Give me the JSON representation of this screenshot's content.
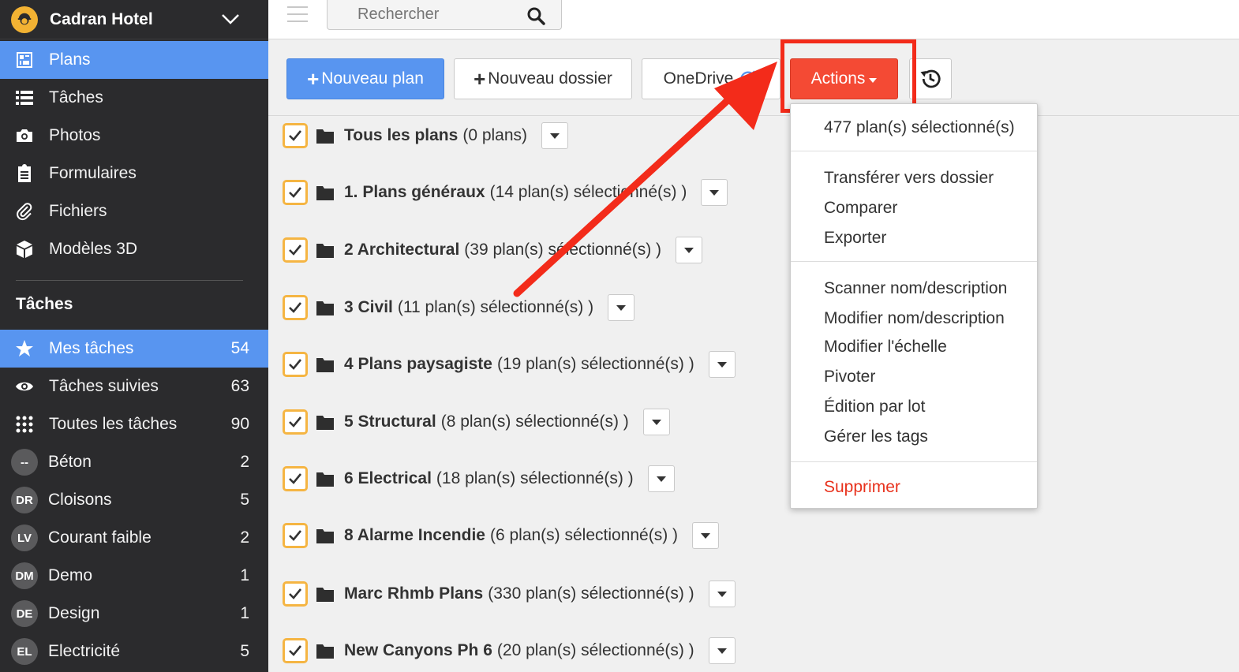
{
  "brand": {
    "name": "Cadran Hotel"
  },
  "nav": [
    {
      "label": "Plans",
      "icon": "plans-icon",
      "active": true
    },
    {
      "label": "Tâches",
      "icon": "list-icon"
    },
    {
      "label": "Photos",
      "icon": "camera-icon"
    },
    {
      "label": "Formulaires",
      "icon": "clipboard-icon"
    },
    {
      "label": "Fichiers",
      "icon": "paperclip-icon"
    },
    {
      "label": "Modèles 3D",
      "icon": "cube-icon"
    }
  ],
  "tasks_section": {
    "title": "Tâches",
    "items": [
      {
        "label": "Mes tâches",
        "count": "54",
        "icon": "star-icon",
        "active": true
      },
      {
        "label": "Tâches suivies",
        "count": "63",
        "icon": "eye-icon"
      },
      {
        "label": "Toutes les tâches",
        "count": "90",
        "icon": "grid-icon"
      },
      {
        "label": "Béton",
        "count": "2",
        "avatar": "--"
      },
      {
        "label": "Cloisons",
        "count": "5",
        "avatar": "DR"
      },
      {
        "label": "Courant faible",
        "count": "2",
        "avatar": "LV"
      },
      {
        "label": "Demo",
        "count": "1",
        "avatar": "DM"
      },
      {
        "label": "Design",
        "count": "1",
        "avatar": "DE"
      },
      {
        "label": "Electricité",
        "count": "5",
        "avatar": "EL"
      }
    ]
  },
  "search": {
    "placeholder": "Rechercher"
  },
  "toolbar": {
    "new_plan": "Nouveau plan",
    "new_folder": "Nouveau dossier",
    "onedrive": "OneDrive",
    "actions": "Actions"
  },
  "folders": [
    {
      "name": "Tous les plans",
      "detail": "(0 plans)"
    },
    {
      "name": "1. Plans généraux",
      "detail": "(14 plan(s) sélectionné(s) )"
    },
    {
      "name": "2 Architectural",
      "detail": "(39 plan(s) sélectionné(s) )"
    },
    {
      "name": "3 Civil",
      "detail": "(11 plan(s) sélectionné(s) )"
    },
    {
      "name": "4 Plans paysagiste",
      "detail": "(19 plan(s) sélectionné(s) )"
    },
    {
      "name": "5 Structural",
      "detail": "(8 plan(s) sélectionné(s) )"
    },
    {
      "name": "6 Electrical",
      "detail": "(18 plan(s) sélectionné(s) )"
    },
    {
      "name": "8 Alarme Incendie",
      "detail": "(6 plan(s) sélectionné(s) )"
    },
    {
      "name": "Marc Rhmb Plans",
      "detail": "(330 plan(s) sélectionné(s) )"
    },
    {
      "name": "New Canyons Ph 6",
      "detail": "(20 plan(s) sélectionné(s) )"
    }
  ],
  "actions_menu": {
    "selected_count": "477 plan(s) sélectionné(s)",
    "group1": [
      "Transférer vers dossier",
      "Comparer",
      "Exporter"
    ],
    "group2": [
      "Scanner nom/description",
      "Modifier nom/description",
      "Modifier l'échelle",
      "Pivoter",
      "Édition par lot",
      "Gérer les tags"
    ],
    "delete": "Supprimer"
  },
  "colors": {
    "accent": "#5895f0",
    "danger": "#f44a34",
    "checkbox": "#f5b543",
    "sidebar": "#2b2b2d"
  }
}
